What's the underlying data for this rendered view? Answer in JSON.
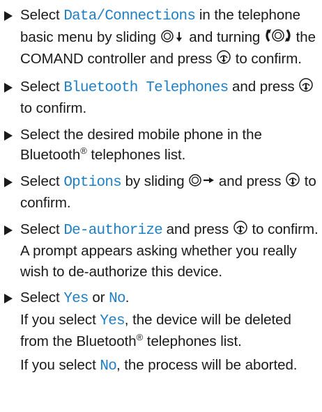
{
  "steps": [
    {
      "segments": [
        {
          "t": "Select "
        },
        {
          "m": "Data/Connections"
        },
        {
          "t": " in the telephone basic menu by sliding "
        },
        {
          "icon": "controller-slide-down-icon"
        },
        {
          "t": " and turning "
        },
        {
          "icon": "controller-turn-icon"
        },
        {
          "t": " the COMAND controller and press "
        },
        {
          "icon": "controller-press-icon"
        },
        {
          "t": " to confirm."
        }
      ]
    },
    {
      "segments": [
        {
          "t": "Select "
        },
        {
          "m": "Bluetooth Telephones"
        },
        {
          "t": " and press "
        },
        {
          "icon": "controller-press-icon"
        },
        {
          "t": " to confirm."
        }
      ]
    },
    {
      "segments": [
        {
          "t": "Select the desired mobile phone in the Bluetooth"
        },
        {
          "sup": "®"
        },
        {
          "t": " telephones list."
        }
      ]
    },
    {
      "segments": [
        {
          "t": "Select "
        },
        {
          "m": "Options"
        },
        {
          "t": " by sliding "
        },
        {
          "icon": "controller-slide-right-icon"
        },
        {
          "t": " and press "
        },
        {
          "icon": "controller-press-icon"
        },
        {
          "t": " to confirm."
        }
      ]
    },
    {
      "segments": [
        {
          "t": "Select "
        },
        {
          "m": "De-authorize"
        },
        {
          "t": " and press "
        },
        {
          "icon": "controller-press-icon"
        },
        {
          "t": " to confirm."
        },
        {
          "br": "note"
        },
        {
          "t": "A prompt appears asking whether you really wish to de-authorize this device."
        }
      ]
    },
    {
      "segments": [
        {
          "t": "Select "
        },
        {
          "m": "Yes"
        },
        {
          "t": " or "
        },
        {
          "m": "No"
        },
        {
          "t": "."
        },
        {
          "br": "note"
        },
        {
          "t": "If you select "
        },
        {
          "m": "Yes"
        },
        {
          "t": ", the device will be deleted from the Bluetooth"
        },
        {
          "sup": "®"
        },
        {
          "t": " telephones list."
        },
        {
          "br": "gap"
        },
        {
          "t": "If you select "
        },
        {
          "m": "No"
        },
        {
          "t": ", the process will be aborted."
        }
      ]
    }
  ],
  "colors": {
    "display_text": "#1f7fc5",
    "body_text": "#1a1a1a"
  }
}
